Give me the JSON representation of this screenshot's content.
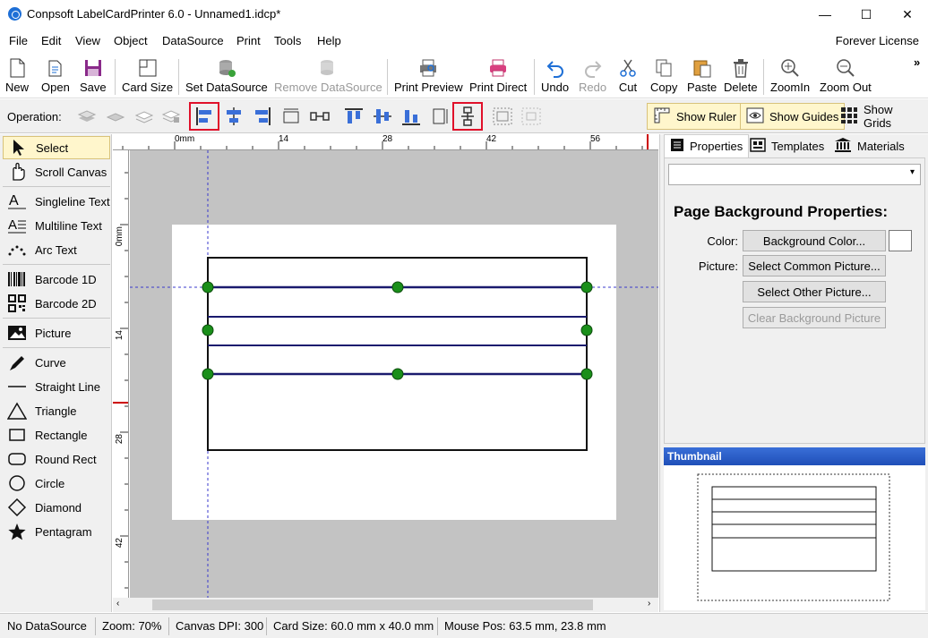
{
  "window": {
    "title": "Conpsoft LabelCardPrinter 6.0 - Unnamed1.idcp*",
    "minimize": "—",
    "maximize": "☐",
    "close": "✕"
  },
  "menu": {
    "items": [
      "File",
      "Edit",
      "View",
      "Object",
      "DataSource",
      "Print",
      "Tools",
      "Help"
    ],
    "license": "Forever License"
  },
  "toolbar": {
    "new": "New",
    "open": "Open",
    "save": "Save",
    "card_size": "Card Size",
    "set_datasource": "Set DataSource",
    "remove_datasource": "Remove DataSource",
    "print_preview": "Print Preview",
    "print_direct": "Print Direct",
    "undo": "Undo",
    "redo": "Redo",
    "cut": "Cut",
    "copy": "Copy",
    "paste": "Paste",
    "delete": "Delete",
    "zoom_in": "ZoomIn",
    "zoom_out": "Zoom Out",
    "overflow": "»"
  },
  "operation": {
    "label": "Operation:",
    "show_ruler": "Show Ruler",
    "show_guides": "Show Guides",
    "show_grids": "Show Grids"
  },
  "tools": {
    "select": "Select",
    "scroll": "Scroll Canvas",
    "singleline": "Singleline Text",
    "multiline": "Multiline Text",
    "arc": "Arc Text",
    "barcode1d": "Barcode 1D",
    "barcode2d": "Barcode 2D",
    "picture": "Picture",
    "curve": "Curve",
    "straight_line": "Straight Line",
    "triangle": "Triangle",
    "rectangle": "Rectangle",
    "round_rect": "Round Rect",
    "circle": "Circle",
    "diamond": "Diamond",
    "pentagram": "Pentagram"
  },
  "ruler": {
    "top_labels": [
      "0mm",
      "14",
      "28",
      "42",
      "56"
    ],
    "left_labels": [
      "0mm",
      "14",
      "28",
      "42"
    ]
  },
  "right_panel": {
    "tabs": {
      "properties": "Properties",
      "templates": "Templates",
      "materials": "Materials"
    },
    "combo_value": "",
    "title": "Page Background Properties:",
    "color_label": "Color:",
    "color_button": "Background Color...",
    "picture_label": "Picture:",
    "common_picture_button": "Select Common Picture...",
    "other_picture_button": "Select Other Picture...",
    "clear_button": "Clear Background Picture",
    "thumbnail_header": "Thumbnail"
  },
  "status": {
    "datasource": "No DataSource",
    "zoom": "Zoom: 70%",
    "dpi": "Canvas DPI: 300",
    "card_size": "Card Size: 60.0 mm x 40.0 mm",
    "mouse_pos": "Mouse Pos: 63.5 mm, 23.8 mm"
  },
  "colors": {
    "accent_select": "#fff6cc",
    "highlight_box": "#e0102a",
    "handle": "#1a8f1a",
    "line": "#1a1a6e",
    "thumbnail_header": "#2456c4"
  }
}
